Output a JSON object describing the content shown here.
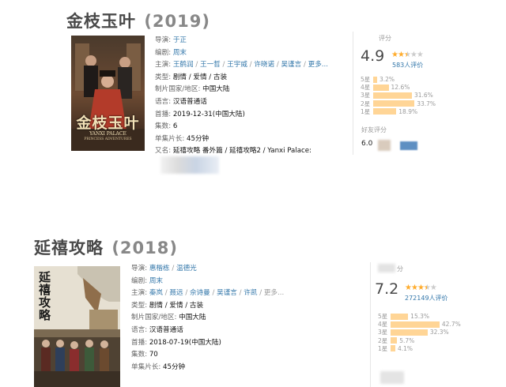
{
  "entries": [
    {
      "title": "金枝玉叶",
      "year": "(2019)",
      "info": {
        "director_key": "导演:",
        "director": "于正",
        "writer_key": "编剧:",
        "writer": "周末",
        "cast_key": "主演:",
        "cast": [
          "王鹤润",
          "王一哲",
          "王宇威",
          "许晓诺",
          "吴谨言",
          "更多..."
        ],
        "type_key": "类型:",
        "type": "剧情 / 爱情 / 古装",
        "country_key": "制片国家/地区:",
        "country": "中国大陆",
        "lang_key": "语言:",
        "lang": "汉语普通话",
        "premiere_key": "首播:",
        "premiere": "2019-12-31(中国大陆)",
        "episodes_key": "集数:",
        "episodes": "6",
        "runtime_key": "单集片长:",
        "runtime": "45分钟",
        "aka_key": "又名:",
        "aka": "延禧攻略 番外篇 / 延禧攻略2 / Yanxi Palace:"
      },
      "poster_text": "金枝玉叶",
      "poster_sub": "YANXI PALACE",
      "poster_sub2": "PRINCESS ADVENTURES",
      "rating": {
        "label": "评分",
        "score": "4.9",
        "stars": 2.5,
        "count": "583人评价",
        "bars": [
          {
            "star": "5星",
            "pct": "3.2%",
            "value": 3.2
          },
          {
            "star": "4星",
            "pct": "12.6%",
            "value": 12.6
          },
          {
            "star": "3星",
            "pct": "31.6%",
            "value": 31.6
          },
          {
            "star": "2星",
            "pct": "33.7%",
            "value": 33.7
          },
          {
            "star": "1星",
            "pct": "18.9%",
            "value": 18.9
          }
        ],
        "friend_label": "好友评分",
        "friend_score": "6.0"
      }
    },
    {
      "title": "延禧攻略",
      "year": "(2018)",
      "info": {
        "director_key": "导演:",
        "director": [
          "惠楷栋",
          "温德光"
        ],
        "writer_key": "编剧:",
        "writer": "周末",
        "cast_key": "主演:",
        "cast": [
          "秦岚",
          "聂远",
          "佘诗曼",
          "吴谨言",
          "许凯",
          "更多..."
        ],
        "type_key": "类型:",
        "type": "剧情 / 爱情 / 古装",
        "country_key": "制片国家/地区:",
        "country": "中国大陆",
        "lang_key": "语言:",
        "lang": "汉语普通话",
        "premiere_key": "首播:",
        "premiere": "2018-07-19(中国大陆)",
        "episodes_key": "集数:",
        "episodes": "70",
        "runtime_key": "单集片长:",
        "runtime": "45分钟"
      },
      "poster_text": "延禧攻略",
      "rating": {
        "label": "分",
        "score": "7.2",
        "stars": 3.5,
        "count": "272149人评价",
        "bars": [
          {
            "star": "5星",
            "pct": "15.3%",
            "value": 15.3
          },
          {
            "star": "4星",
            "pct": "42.7%",
            "value": 42.7
          },
          {
            "star": "3星",
            "pct": "32.3%",
            "value": 32.3
          },
          {
            "star": "2星",
            "pct": "5.7%",
            "value": 5.7
          },
          {
            "star": "1星",
            "pct": "4.1%",
            "value": 4.1
          }
        ]
      }
    }
  ],
  "colors": {
    "link": "#3377aa",
    "bar": "#ffd596",
    "star_on": "#ffac2d",
    "star_off": "#cccccc"
  }
}
